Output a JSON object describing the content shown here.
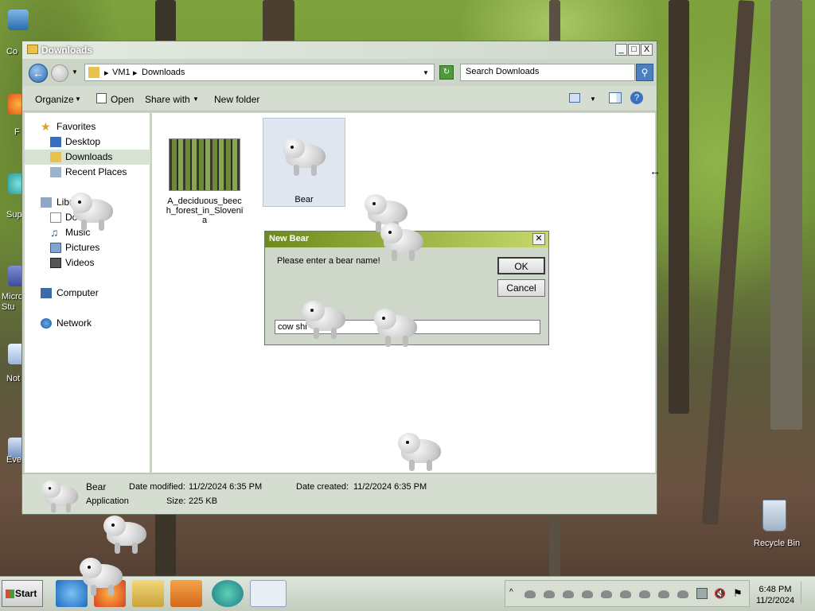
{
  "desktop": {
    "icons": [
      "Co",
      "F",
      "Sup",
      "Micro Stu",
      "Not",
      "Eve"
    ],
    "recycle_bin": "Recycle Bin"
  },
  "explorer": {
    "title": "Downloads",
    "window_buttons": {
      "minimize": "_",
      "maximize": "□",
      "close": "X"
    },
    "breadcrumb": [
      "VM1",
      "Downloads"
    ],
    "search_placeholder": "Search Downloads",
    "commands": {
      "organize": "Organize",
      "open": "Open",
      "share_with": "Share with",
      "new_folder": "New folder"
    },
    "nav": {
      "favorites": "Favorites",
      "desktop": "Desktop",
      "downloads": "Downloads",
      "recent_places": "Recent Places",
      "libraries": "Libra",
      "documents": "Do",
      "music": "Music",
      "pictures": "Pictures",
      "videos": "Videos",
      "computer": "Computer",
      "network": "Network"
    },
    "files": [
      {
        "name": "A_deciduous_beech_forest_in_Slovenia"
      },
      {
        "name": "Bear"
      }
    ],
    "details": {
      "name": "Bear",
      "type": "Application",
      "date_modified_label": "Date modified:",
      "date_modified": "11/2/2024 6:35 PM",
      "date_created_label": "Date created:",
      "date_created": "11/2/2024 6:35 PM",
      "size_label": "Size:",
      "size": "225 KB"
    }
  },
  "dialog": {
    "title": "New Bear",
    "message": "Please enter a bear name!",
    "ok": "OK",
    "cancel": "Cancel",
    "input_value": "cow shi"
  },
  "taskbar": {
    "start": "Start",
    "time": "6:48 PM",
    "date": "11/2/2024"
  }
}
